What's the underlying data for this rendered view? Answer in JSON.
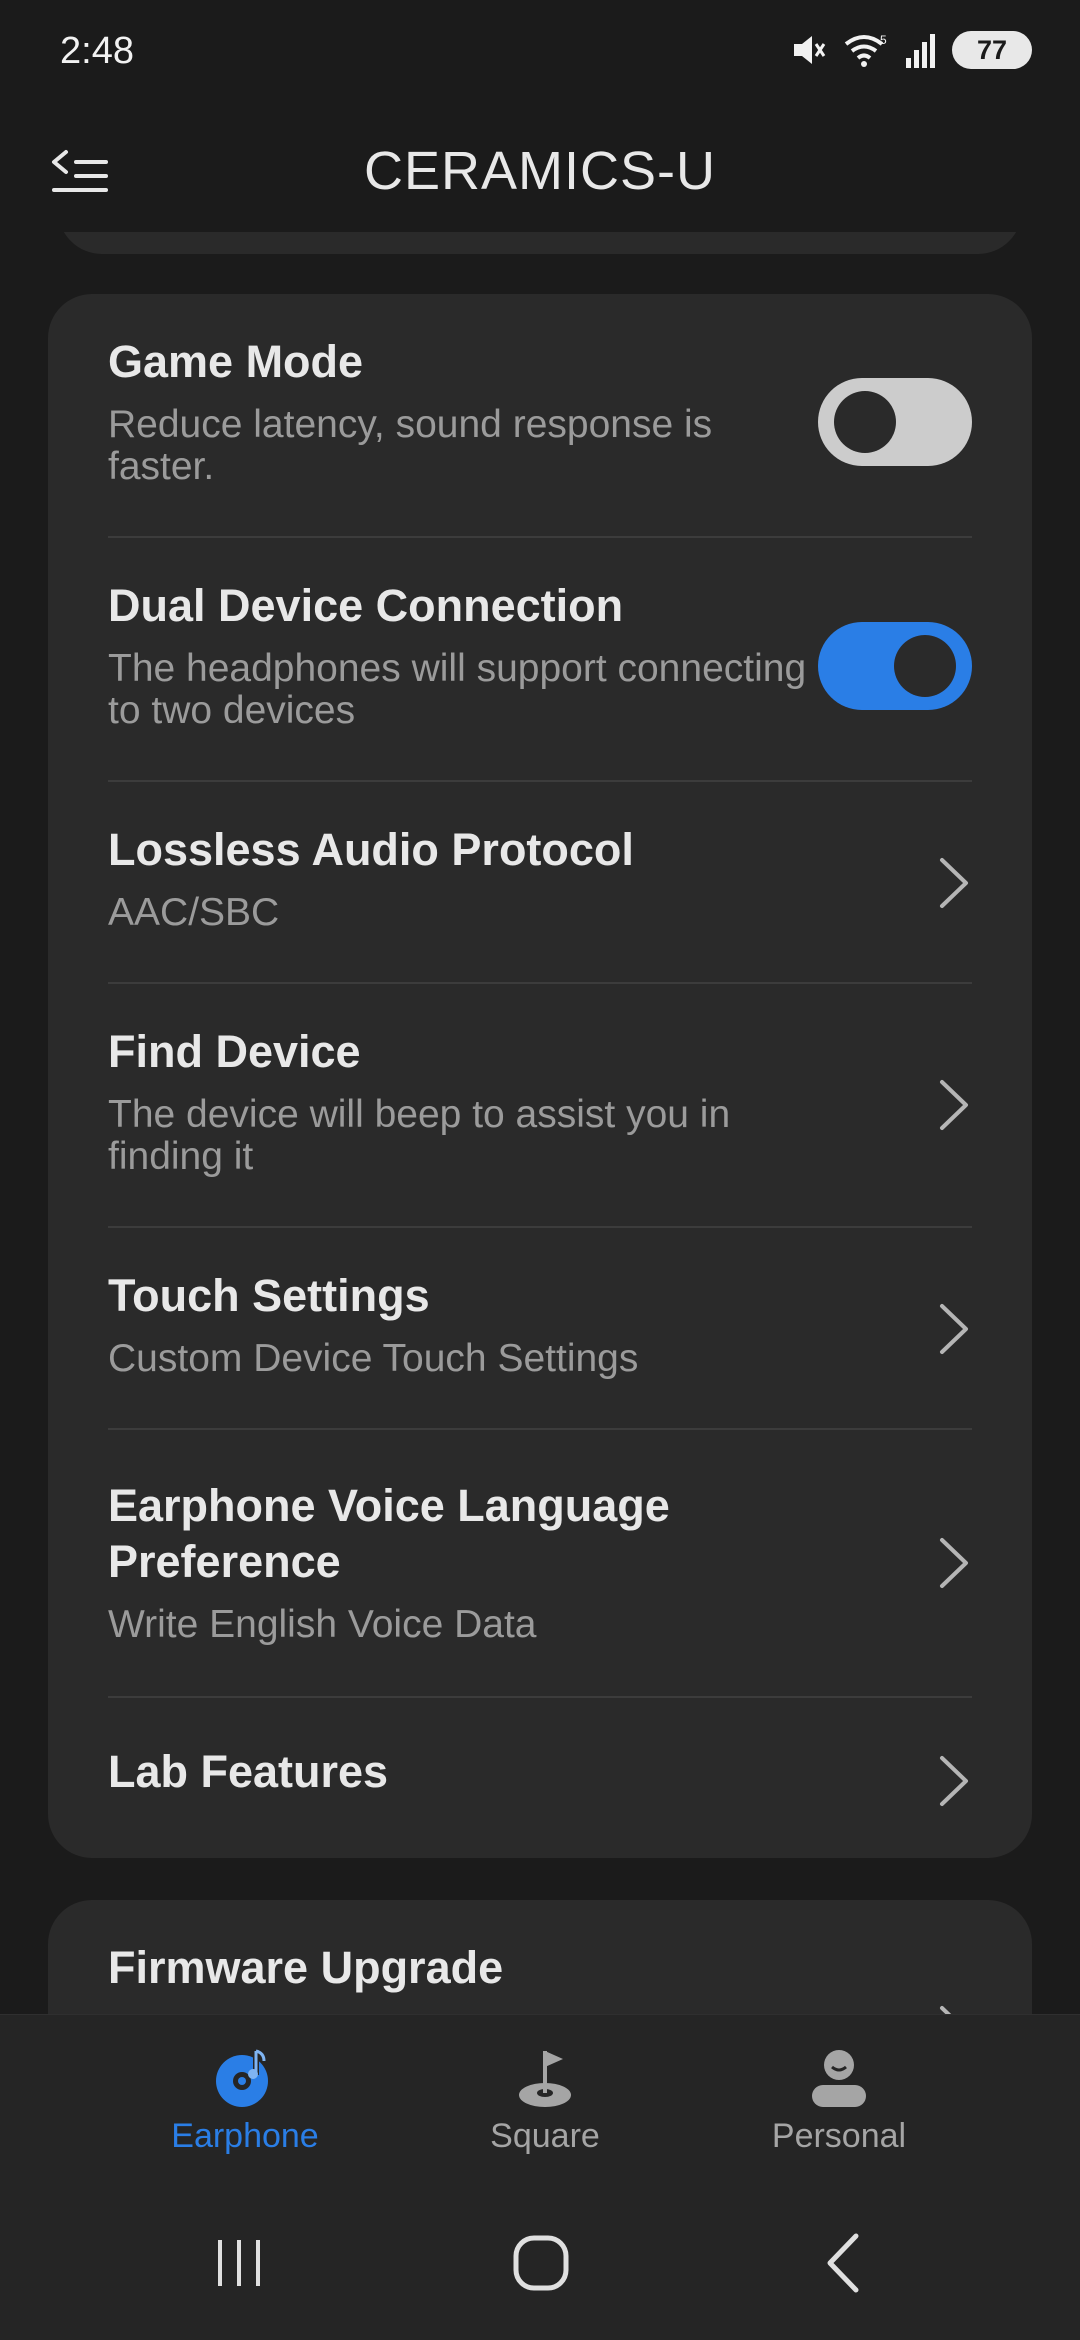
{
  "status_bar": {
    "time": "2:48",
    "wifi_badge": "5",
    "battery_level": "77"
  },
  "app_bar": {
    "title": "CERAMICS-U"
  },
  "settings": [
    {
      "id": "game-mode",
      "title": "Game Mode",
      "description": "Reduce latency, sound response is faster.",
      "control": "toggle",
      "enabled": false
    },
    {
      "id": "dual-device-connection",
      "title": "Dual Device Connection",
      "description": "The headphones will support connecting to two devices",
      "control": "toggle",
      "enabled": true
    },
    {
      "id": "lossless-audio-protocol",
      "title": "Lossless Audio Protocol",
      "description": "AAC/SBC",
      "control": "chevron"
    },
    {
      "id": "find-device",
      "title": "Find Device",
      "description": "The device will beep to assist you in finding it",
      "control": "chevron"
    },
    {
      "id": "touch-settings",
      "title": "Touch Settings",
      "description": "Custom Device Touch Settings",
      "control": "chevron"
    },
    {
      "id": "earphone-voice-language",
      "title": "Earphone Voice Language Preference",
      "description": "Write English Voice Data",
      "control": "chevron"
    },
    {
      "id": "lab-features",
      "title": "Lab Features",
      "description": "",
      "control": "chevron"
    }
  ],
  "firmware": {
    "title": "Firmware Upgrade"
  },
  "bottom_nav": [
    {
      "label": "Earphone",
      "icon": "earphone-icon",
      "active": true
    },
    {
      "label": "Square",
      "icon": "flag-icon",
      "active": false
    },
    {
      "label": "Personal",
      "icon": "person-icon",
      "active": false
    }
  ],
  "colors": {
    "accent": "#2a7ee6",
    "background": "#1b1b1b",
    "card": "#2a2a2a"
  }
}
